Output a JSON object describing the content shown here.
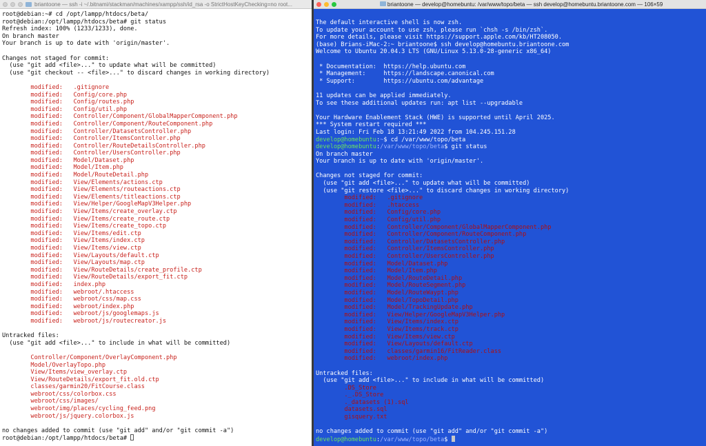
{
  "left_window": {
    "title": "briantoone — ssh -i ~/.bitnami/stackman/machines/xampp/ssh/id_rsa -o StrictHostKeyChecking=no root...",
    "lines": [
      {
        "t": "root@debian:~# cd /opt/lampp/htdocs/beta/"
      },
      {
        "t": "root@debian:/opt/lampp/htdocs/beta# git status"
      },
      {
        "t": "Refresh index: 100% (1233/1233), done."
      },
      {
        "t": "On branch master"
      },
      {
        "t": "Your branch is up to date with 'origin/master'."
      },
      {
        "t": ""
      },
      {
        "t": "Changes not staged for commit:"
      },
      {
        "t": "  (use \"git add <file>...\" to update what will be committed)"
      },
      {
        "t": "  (use \"git checkout -- <file>...\" to discard changes in working directory)"
      },
      {
        "t": ""
      },
      {
        "t": "\tmodified:   .gitignore",
        "c": "red"
      },
      {
        "t": "\tmodified:   Config/core.php",
        "c": "red"
      },
      {
        "t": "\tmodified:   Config/routes.php",
        "c": "red"
      },
      {
        "t": "\tmodified:   Config/util.php",
        "c": "red"
      },
      {
        "t": "\tmodified:   Controller/Component/GlobalMapperComponent.php",
        "c": "red"
      },
      {
        "t": "\tmodified:   Controller/Component/RouteComponent.php",
        "c": "red"
      },
      {
        "t": "\tmodified:   Controller/DatasetsController.php",
        "c": "red"
      },
      {
        "t": "\tmodified:   Controller/ItemsController.php",
        "c": "red"
      },
      {
        "t": "\tmodified:   Controller/RouteDetailsController.php",
        "c": "red"
      },
      {
        "t": "\tmodified:   Controller/UsersController.php",
        "c": "red"
      },
      {
        "t": "\tmodified:   Model/Dataset.php",
        "c": "red"
      },
      {
        "t": "\tmodified:   Model/Item.php",
        "c": "red"
      },
      {
        "t": "\tmodified:   Model/RouteDetail.php",
        "c": "red"
      },
      {
        "t": "\tmodified:   View/Elements/actions.ctp",
        "c": "red"
      },
      {
        "t": "\tmodified:   View/Elements/routeactions.ctp",
        "c": "red"
      },
      {
        "t": "\tmodified:   View/Elements/titleactions.ctp",
        "c": "red"
      },
      {
        "t": "\tmodified:   View/Helper/GoogleMapV3Helper.php",
        "c": "red"
      },
      {
        "t": "\tmodified:   View/Items/create_overlay.ctp",
        "c": "red"
      },
      {
        "t": "\tmodified:   View/Items/create_route.ctp",
        "c": "red"
      },
      {
        "t": "\tmodified:   View/Items/create_topo.ctp",
        "c": "red"
      },
      {
        "t": "\tmodified:   View/Items/edit.ctp",
        "c": "red"
      },
      {
        "t": "\tmodified:   View/Items/index.ctp",
        "c": "red"
      },
      {
        "t": "\tmodified:   View/Items/view.ctp",
        "c": "red"
      },
      {
        "t": "\tmodified:   View/Layouts/default.ctp",
        "c": "red"
      },
      {
        "t": "\tmodified:   View/Layouts/map.ctp",
        "c": "red"
      },
      {
        "t": "\tmodified:   View/RouteDetails/create_profile.ctp",
        "c": "red"
      },
      {
        "t": "\tmodified:   View/RouteDetails/export_fit.ctp",
        "c": "red"
      },
      {
        "t": "\tmodified:   index.php",
        "c": "red"
      },
      {
        "t": "\tmodified:   webroot/.htaccess",
        "c": "red"
      },
      {
        "t": "\tmodified:   webroot/css/map.css",
        "c": "red"
      },
      {
        "t": "\tmodified:   webroot/index.php",
        "c": "red"
      },
      {
        "t": "\tmodified:   webroot/js/googlemaps.js",
        "c": "red"
      },
      {
        "t": "\tmodified:   webroot/js/routecreator.js",
        "c": "red"
      },
      {
        "t": ""
      },
      {
        "t": "Untracked files:"
      },
      {
        "t": "  (use \"git add <file>...\" to include in what will be committed)"
      },
      {
        "t": ""
      },
      {
        "t": "\tController/Component/OverlayComponent.php",
        "c": "red"
      },
      {
        "t": "\tModel/OverlayTopo.php",
        "c": "red"
      },
      {
        "t": "\tView/Items/view_overlay.ctp",
        "c": "red"
      },
      {
        "t": "\tView/RouteDetails/export_fit.old.ctp",
        "c": "red"
      },
      {
        "t": "\tclasses/garmin20/FitCourse.class",
        "c": "red"
      },
      {
        "t": "\twebroot/css/colorbox.css",
        "c": "red"
      },
      {
        "t": "\twebroot/css/images/",
        "c": "red"
      },
      {
        "t": "\twebroot/img/places/cycling_feed.png",
        "c": "red"
      },
      {
        "t": "\twebroot/js/jquery.colorbox.js",
        "c": "red"
      },
      {
        "t": ""
      },
      {
        "t": "no changes added to commit (use \"git add\" and/or \"git commit -a\")"
      },
      {
        "t": "root@debian:/opt/lampp/htdocs/beta# ",
        "cursor": true
      }
    ]
  },
  "right_window": {
    "title": "briantoone — develop@homebuntu: /var/www/topo/beta — ssh develop@homebuntu.briantoone.com — 106×59",
    "lines": [
      {
        "t": "The default interactive shell is now zsh."
      },
      {
        "t": "To update your account to use zsh, please run `chsh -s /bin/zsh`."
      },
      {
        "t": "For more details, please visit https://support.apple.com/kb/HT208050."
      },
      {
        "t": "(base) Brians-iMac-2:~ briantoone$ ssh develop@homebuntu.briantoone.com"
      },
      {
        "t": "Welcome to Ubuntu 20.04.3 LTS (GNU/Linux 5.13.0-28-generic x86_64)"
      },
      {
        "t": ""
      },
      {
        "t": " * Documentation:  https://help.ubuntu.com"
      },
      {
        "t": " * Management:     https://landscape.canonical.com"
      },
      {
        "t": " * Support:        https://ubuntu.com/advantage"
      },
      {
        "t": ""
      },
      {
        "t": "11 updates can be applied immediately."
      },
      {
        "t": "To see these additional updates run: apt list --upgradable"
      },
      {
        "t": ""
      },
      {
        "t": "Your Hardware Enablement Stack (HWE) is supported until April 2025."
      },
      {
        "t": "*** System restart required ***"
      },
      {
        "t": "Last login: Fri Feb 18 13:21:49 2022 from 104.245.151.28"
      },
      {
        "u": "develop@homebuntu",
        "p": "~",
        "t": "$ cd /var/www/topo/beta"
      },
      {
        "u": "develop@homebuntu",
        "p": "/var/www/topo/beta",
        "t": "$ git status"
      },
      {
        "t": "On branch master"
      },
      {
        "t": "Your branch is up to date with 'origin/master'."
      },
      {
        "t": ""
      },
      {
        "t": "Changes not staged for commit:"
      },
      {
        "t": "  (use \"git add <file>...\" to update what will be committed)"
      },
      {
        "t": "  (use \"git restore <file>...\" to discard changes in working directory)"
      },
      {
        "t": "\tmodified:   .gitignore",
        "c": "red"
      },
      {
        "t": "\tmodified:   .htaccess",
        "c": "red"
      },
      {
        "t": "\tmodified:   Config/core.php",
        "c": "red"
      },
      {
        "t": "\tmodified:   Config/util.php",
        "c": "red"
      },
      {
        "t": "\tmodified:   Controller/Component/GlobalMapperComponent.php",
        "c": "red"
      },
      {
        "t": "\tmodified:   Controller/Component/RouteComponent.php",
        "c": "red"
      },
      {
        "t": "\tmodified:   Controller/DatasetsController.php",
        "c": "red"
      },
      {
        "t": "\tmodified:   Controller/ItemsController.php",
        "c": "red"
      },
      {
        "t": "\tmodified:   Controller/UsersController.php",
        "c": "red"
      },
      {
        "t": "\tmodified:   Model/Dataset.php",
        "c": "red"
      },
      {
        "t": "\tmodified:   Model/Item.php",
        "c": "red"
      },
      {
        "t": "\tmodified:   Model/RouteDetail.php",
        "c": "red"
      },
      {
        "t": "\tmodified:   Model/RouteSegment.php",
        "c": "red"
      },
      {
        "t": "\tmodified:   Model/RouteWaypt.php",
        "c": "red"
      },
      {
        "t": "\tmodified:   Model/TopoDetail.php",
        "c": "red"
      },
      {
        "t": "\tmodified:   Model/TrackingUpdate.php",
        "c": "red"
      },
      {
        "t": "\tmodified:   View/Helper/GoogleMapV3Helper.php",
        "c": "red"
      },
      {
        "t": "\tmodified:   View/Items/index.ctp",
        "c": "red"
      },
      {
        "t": "\tmodified:   View/Items/track.ctp",
        "c": "red"
      },
      {
        "t": "\tmodified:   View/Items/view.ctp",
        "c": "red"
      },
      {
        "t": "\tmodified:   View/Layouts/default.ctp",
        "c": "red"
      },
      {
        "t": "\tmodified:   classes/garmin16/FitReader.class",
        "c": "red"
      },
      {
        "t": "\tmodified:   webroot/index.php",
        "c": "red"
      },
      {
        "t": ""
      },
      {
        "t": "Untracked files:"
      },
      {
        "t": "  (use \"git add <file>...\" to include in what will be committed)"
      },
      {
        "t": "\t.DS_Store",
        "c": "red"
      },
      {
        "t": "\t._.DS_Store",
        "c": "red"
      },
      {
        "t": "\t._datasets (1).sql",
        "c": "red"
      },
      {
        "t": "\tdatasets.sql",
        "c": "red"
      },
      {
        "t": "\tgisquery.txt",
        "c": "red"
      },
      {
        "t": ""
      },
      {
        "t": "no changes added to commit (use \"git add\" and/or \"git commit -a\")"
      },
      {
        "u": "develop@homebuntu",
        "p": "/var/www/topo/beta",
        "t": "$ ",
        "cursor": true
      }
    ]
  }
}
